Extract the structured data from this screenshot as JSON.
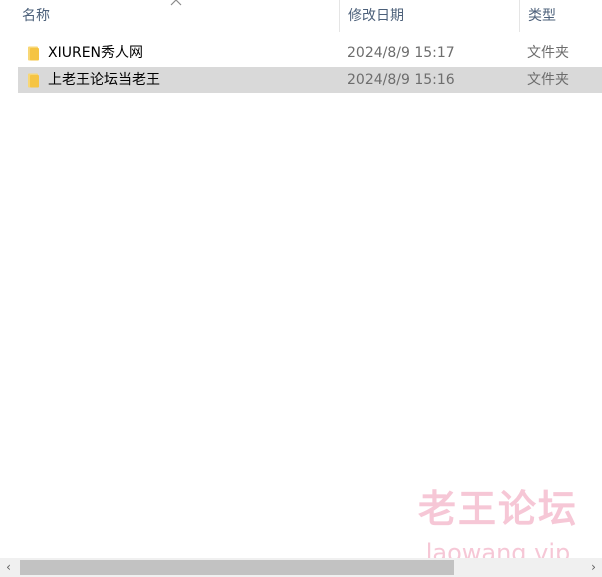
{
  "columns": {
    "name": "名称",
    "date_modified": "修改日期",
    "type": "类型"
  },
  "sort": {
    "column": "name",
    "direction": "ascending"
  },
  "files": [
    {
      "icon": "folder-icon",
      "name": "XIUREN秀人网",
      "date_modified": "2024/8/9 15:17",
      "type": "文件夹",
      "selected": false
    },
    {
      "icon": "folder-icon",
      "name": "上老王论坛当老王",
      "date_modified": "2024/8/9 15:16",
      "type": "文件夹",
      "selected": true
    }
  ],
  "watermark": {
    "line1": "老王论坛",
    "line2": "laowang.vip"
  },
  "colors": {
    "header_text": "#4c607a",
    "selection": "#d9d9d9",
    "folder": "#f5c443",
    "watermark": "#f6c7d6"
  }
}
